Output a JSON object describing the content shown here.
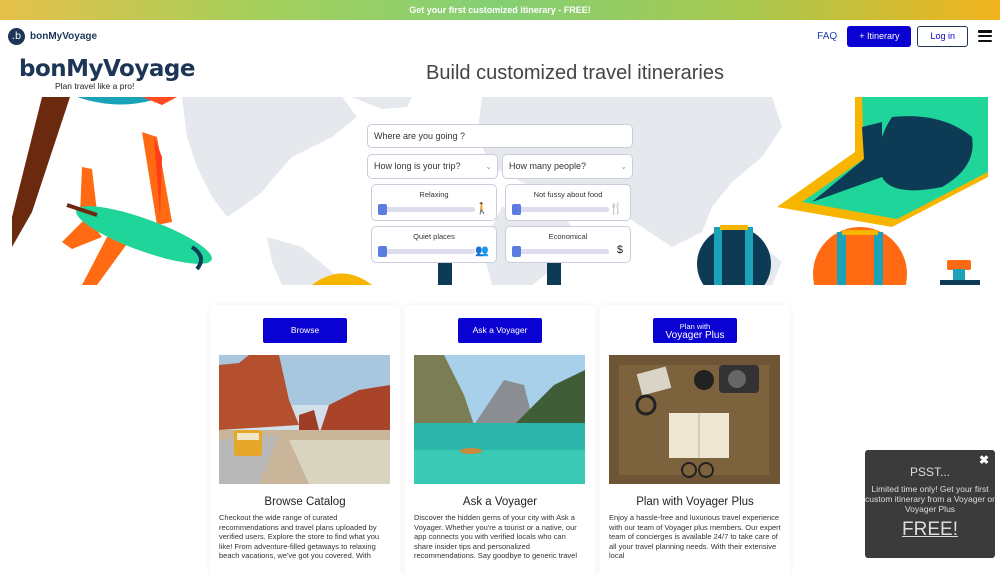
{
  "promo": {
    "text": "Get your first customized itinerary - FREE!"
  },
  "nav": {
    "logo_letter": ".b",
    "brand": "bonMyVoyage",
    "faq": "FAQ",
    "itinerary_button": "+ Itinerary",
    "login_button": "Log in",
    "menu_icon": "hamburger-icon"
  },
  "hero": {
    "brand": "bonMyVoyage",
    "tagline": "Plan travel like a pro!",
    "title": "Build customized travel itineraries"
  },
  "search": {
    "destination_placeholder": "Where are you going ?",
    "trip_length": {
      "value": "How long is your trip?"
    },
    "people": {
      "value": "How many people?"
    },
    "sliders": [
      {
        "label": "Relaxing",
        "icon": "hiking-icon",
        "glyph": "🚶",
        "value": 0
      },
      {
        "label": "Not fussy about food",
        "icon": "utensil-icon",
        "glyph": "🍴",
        "value": 0
      },
      {
        "label": "Quiet places",
        "icon": "crowd-icon",
        "glyph": "👥",
        "value": 0
      },
      {
        "label": "Economical",
        "icon": "dollar-icon",
        "glyph": "$",
        "value": 0
      }
    ]
  },
  "cards": [
    {
      "button": "Browse",
      "image": "desert-road-van-photo",
      "title": "Browse Catalog",
      "text": "Checkout the wide range of curated recommendations and travel plans uploaded by verified users. Explore the store to find what you like! From adventure-filled getaways to relaxing beach vacations, we've got you covered. With"
    },
    {
      "button": "Ask a Voyager",
      "image": "mountain-lake-boat-photo",
      "title": "Ask a Voyager",
      "text": "Discover the hidden gems of your city with Ask a Voyager. Whether you're a tourist or a native, our app connects you with verified locals who can share insider tips and personalized recommendations. Say goodbye to generic travel"
    },
    {
      "button_line1": "Plan with",
      "button_line2": "Voyager Plus",
      "image": "travel-desk-camera-photo",
      "title": "Plan with Voyager Plus",
      "text": "Enjoy a hassle-free and luxurious travel experience with our team of Voyager plus members. Our expert team of concierges is available 24/7 to take care of all your travel planning needs. With their extensive local"
    }
  ],
  "popup": {
    "close": "✖",
    "title": "PSST...",
    "text": "Limited time only! Get your first custom itinerary from a Voyager or Voyager Plus",
    "cta": "FREE!"
  },
  "colors": {
    "brand_navy": "#1d3557",
    "primary_button": "#0a02d2",
    "slider_thumb": "#5b7de0",
    "popup_bg": "#3b3b3b"
  }
}
